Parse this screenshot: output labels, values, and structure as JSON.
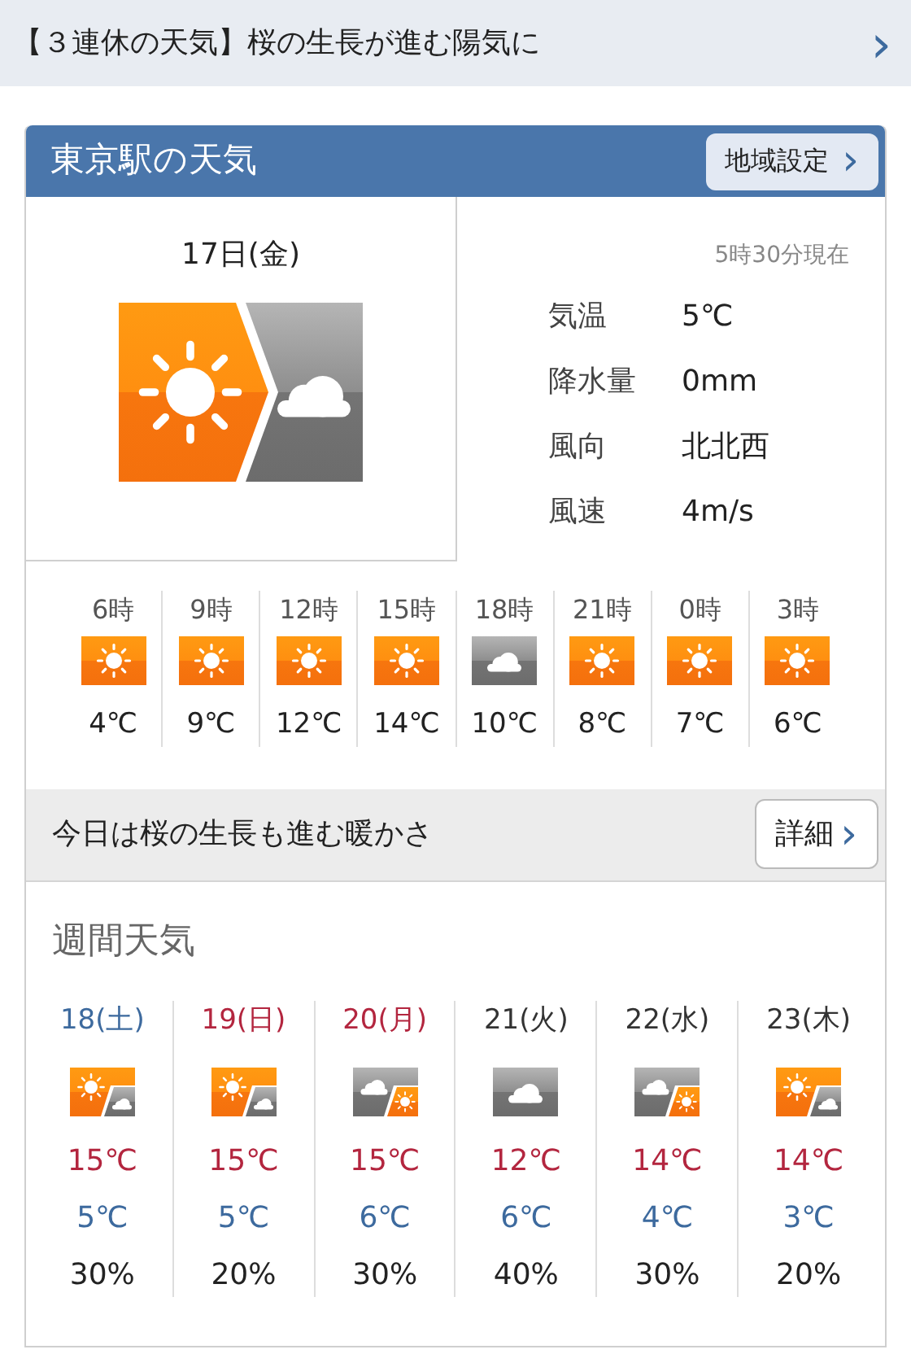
{
  "banner": {
    "text": "【３連休の天気】桜の生長が進む陽気に",
    "chevron": "›"
  },
  "header": {
    "title": "東京駅の天気",
    "button": "地域設定",
    "button_chevron": "›"
  },
  "today": {
    "date": "17日(金)",
    "kind": "suncloud",
    "observed": "5時30分現在",
    "stats": [
      {
        "label": "気温",
        "value": "5℃"
      },
      {
        "label": "降水量",
        "value": "0mm"
      },
      {
        "label": "風向",
        "value": "北北西"
      },
      {
        "label": "風速",
        "value": "4m/s"
      }
    ]
  },
  "hourly": [
    {
      "time": "6時",
      "kind": "sun",
      "temp": "4℃"
    },
    {
      "time": "9時",
      "kind": "sun",
      "temp": "9℃"
    },
    {
      "time": "12時",
      "kind": "sun",
      "temp": "12℃"
    },
    {
      "time": "15時",
      "kind": "sun",
      "temp": "14℃"
    },
    {
      "time": "18時",
      "kind": "cloud",
      "temp": "10℃"
    },
    {
      "time": "21時",
      "kind": "sun",
      "temp": "8℃"
    },
    {
      "time": "0時",
      "kind": "sun",
      "temp": "7℃"
    },
    {
      "time": "3時",
      "kind": "sun",
      "temp": "6℃"
    }
  ],
  "summary": {
    "text": "今日は桜の生長も進む暖かさ",
    "button": "詳細",
    "button_chevron": "›"
  },
  "weekly": {
    "title": "週間天気",
    "days": [
      {
        "date": "18(土)",
        "color": "#3d6a9e",
        "kind": "suncloud",
        "high": "15℃",
        "low": "5℃",
        "rain": "30%"
      },
      {
        "date": "19(日)",
        "color": "#b3263f",
        "kind": "suncloud",
        "high": "15℃",
        "low": "5℃",
        "rain": "20%"
      },
      {
        "date": "20(月)",
        "color": "#b3263f",
        "kind": "cloudsun",
        "high": "15℃",
        "low": "6℃",
        "rain": "30%"
      },
      {
        "date": "21(火)",
        "color": "#333333",
        "kind": "cloud",
        "high": "12℃",
        "low": "6℃",
        "rain": "40%"
      },
      {
        "date": "22(水)",
        "color": "#333333",
        "kind": "cloudsun",
        "high": "14℃",
        "low": "4℃",
        "rain": "30%"
      },
      {
        "date": "23(木)",
        "color": "#333333",
        "kind": "suncloud",
        "high": "14℃",
        "low": "3℃",
        "rain": "20%"
      }
    ]
  }
}
